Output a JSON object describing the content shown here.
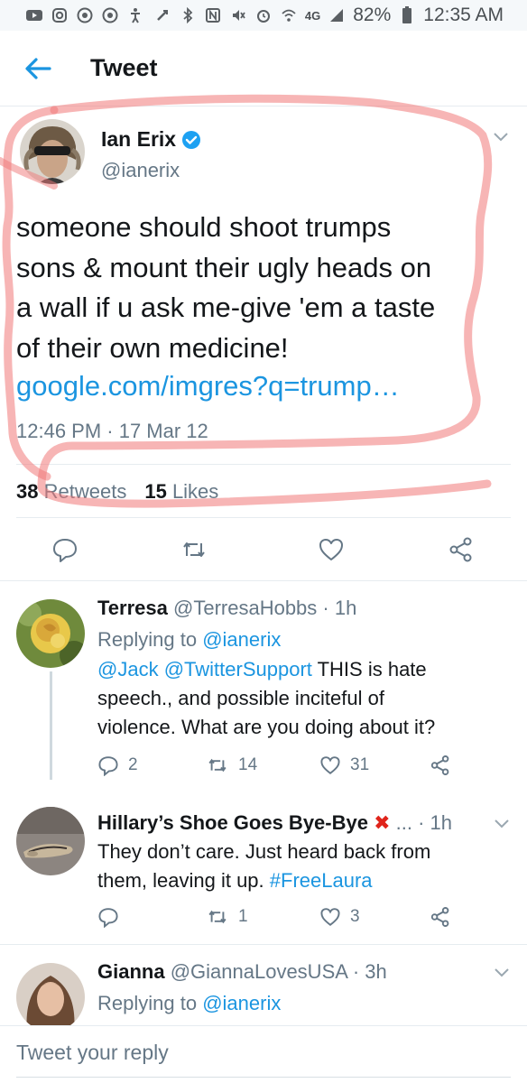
{
  "status_bar": {
    "battery": "82%",
    "time": "12:35 AM",
    "network": "4G",
    "left_icons": [
      "youtube-icon",
      "instagram-icon",
      "chrome-icon",
      "chrome-icon",
      "accessibility-icon"
    ],
    "right_icons": [
      "link-icon",
      "bluetooth-icon",
      "nfc-icon",
      "mute-icon",
      "alarm-icon",
      "wifi-icon",
      "signal-icon",
      "battery-icon"
    ]
  },
  "header": {
    "title": "Tweet",
    "back_icon": "arrow-left-icon"
  },
  "tweet": {
    "author_name": "Ian Erix",
    "verified": true,
    "handle": "@ianerix",
    "text_lines": [
      "someone should shoot trumps",
      "sons & mount their ugly heads on",
      "a wall if u ask me-give 'em a taste",
      "of their own medicine!"
    ],
    "link": "google.com/imgres?q=trump…",
    "timestamp": "12:46 PM · 17 Mar 12",
    "retweets_count": "38",
    "retweets_label": "Retweets",
    "likes_count": "15",
    "likes_label": "Likes",
    "actions": [
      "reply-icon",
      "retweet-icon",
      "like-icon",
      "share-icon"
    ]
  },
  "replies": [
    {
      "name": "Terresa",
      "handle": "@TerresaHobbs · 1h",
      "replying_prefix": "Replying to",
      "replying_to": "@ianerix",
      "mention_1": "@Jack",
      "mention_2": "@TwitterSupport",
      "body_line1_rest": "THIS is hate",
      "body_line2": "speech., and possible inciteful of",
      "body_line3": "violence.  What are you doing about it?",
      "reply_count": "2",
      "retweet_count": "14",
      "like_count": "31"
    },
    {
      "name": "Hillary’s Shoe Goes Bye-Bye",
      "emoji": "✖",
      "handle": "...   · 1h",
      "body_line1": "They don’t care.  Just heard back from",
      "body_line2_text": "them, leaving it up.",
      "hashtag": "#FreeLaura",
      "reply_count": "",
      "retweet_count": "1",
      "like_count": "3"
    },
    {
      "name": "Gianna",
      "handle": "@GiannaLovesUSA · 3h",
      "replying_prefix": "Replying to",
      "replying_to": "@ianerix"
    }
  ],
  "composer": {
    "placeholder": "Tweet your reply"
  },
  "colors": {
    "accent": "#1b95e0",
    "muted": "#657786",
    "text": "#14171a",
    "markup_red": "#f07878",
    "reject_red": "#e0241b"
  }
}
